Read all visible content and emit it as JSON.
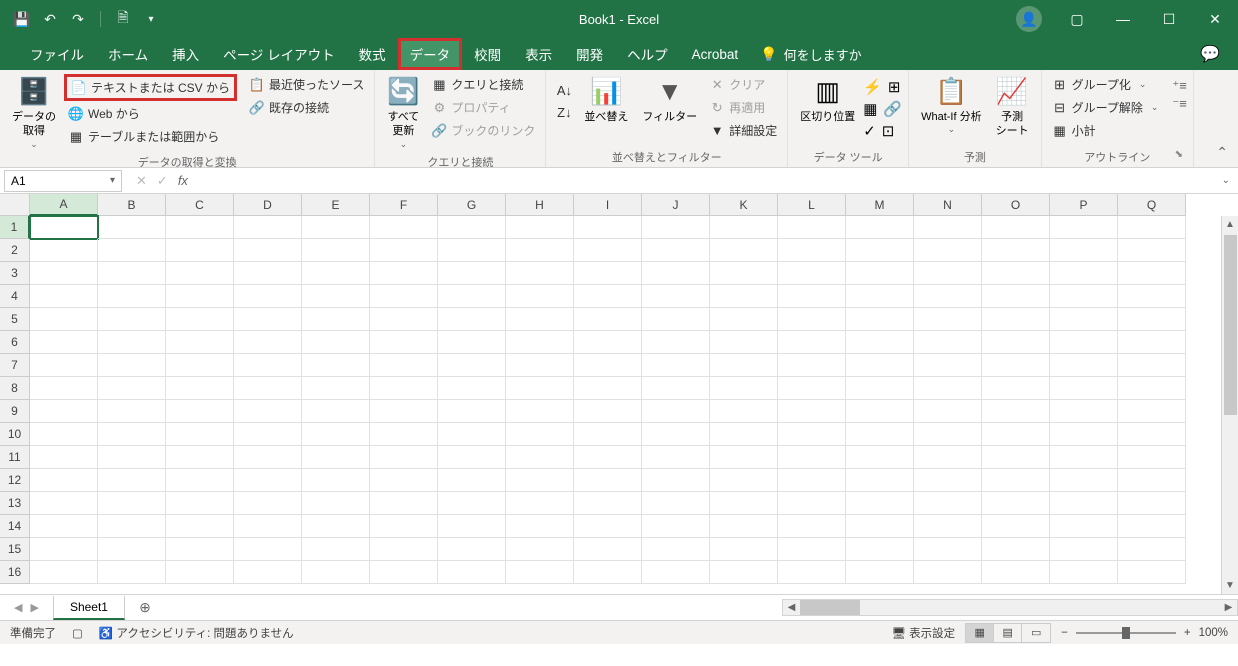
{
  "title": "Book1  -  Excel",
  "tabs": [
    "ファイル",
    "ホーム",
    "挿入",
    "ページ レイアウト",
    "数式",
    "データ",
    "校閲",
    "表示",
    "開発",
    "ヘルプ",
    "Acrobat"
  ],
  "active_tab": "データ",
  "tell_me": "何をしますか",
  "ribbon": {
    "group1": {
      "get_data": "データの\n取得",
      "csv": "テキストまたは CSV から",
      "web": "Web から",
      "table": "テーブルまたは範囲から",
      "recent": "最近使ったソース",
      "existing": "既存の接続",
      "label": "データの取得と変換"
    },
    "group2": {
      "refresh": "すべて\n更新",
      "conn": "クエリと接続",
      "prop": "プロパティ",
      "links": "ブックのリンク",
      "label": "クエリと接続"
    },
    "group3": {
      "sort": "並べ替え",
      "filter": "フィルター",
      "clear": "クリア",
      "reapply": "再適用",
      "adv": "詳細設定",
      "label": "並べ替えとフィルター"
    },
    "group4": {
      "text_col": "区切り位置",
      "label": "データ ツール"
    },
    "group5": {
      "whatif": "What-If 分析",
      "forecast": "予測\nシート",
      "label": "予測"
    },
    "group6": {
      "group": "グループ化",
      "ungroup": "グループ解除",
      "subtotal": "小計",
      "label": "アウトライン"
    }
  },
  "namebox": "A1",
  "columns": [
    "A",
    "B",
    "C",
    "D",
    "E",
    "F",
    "G",
    "H",
    "I",
    "J",
    "K",
    "L",
    "M",
    "N",
    "O",
    "P",
    "Q"
  ],
  "rows": [
    1,
    2,
    3,
    4,
    5,
    6,
    7,
    8,
    9,
    10,
    11,
    12,
    13,
    14,
    15,
    16
  ],
  "active_cell": "A1",
  "sheet": "Sheet1",
  "status": {
    "ready": "準備完了",
    "acc": "アクセシビリティ: 問題ありません",
    "display": "表示設定",
    "zoom": "100%"
  }
}
